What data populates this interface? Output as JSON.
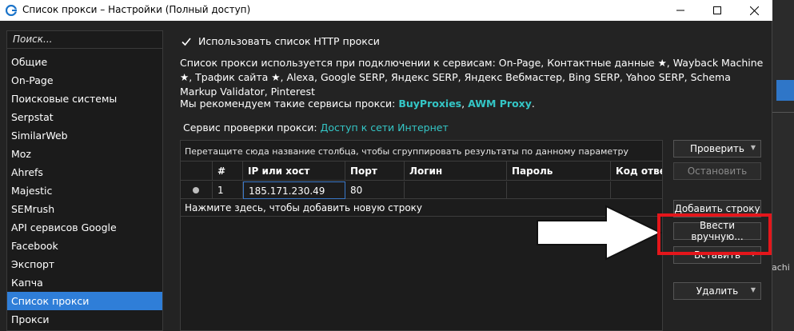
{
  "window": {
    "title": "Список прокси – Настройки (Полный доступ)"
  },
  "icons": {
    "app": "app-logo-icon",
    "minimize": "minimize-icon",
    "maximize": "maximize-icon",
    "close": "close-icon",
    "checkbox": "checkmark-icon",
    "dropdown": "chevron-down-icon",
    "arrow": "arrow-right-icon"
  },
  "colors": {
    "accent": "#2f7ed8",
    "link": "#34c6c6",
    "highlight": "#e4161b"
  },
  "sidebar": {
    "search_placeholder": "Поиск...",
    "items": [
      {
        "label": "Общие"
      },
      {
        "label": "On-Page"
      },
      {
        "label": "Поисковые системы"
      },
      {
        "label": "Serpstat"
      },
      {
        "label": "SimilarWeb"
      },
      {
        "label": "Moz"
      },
      {
        "label": "Ahrefs"
      },
      {
        "label": "Majestic"
      },
      {
        "label": "SEMrush"
      },
      {
        "label": "API сервисов Google"
      },
      {
        "label": "Facebook"
      },
      {
        "label": "Экспорт"
      },
      {
        "label": "Капча"
      },
      {
        "label": "Список прокси",
        "active": true
      },
      {
        "label": "Прокси"
      }
    ]
  },
  "main": {
    "use_list_label": "Использовать список HTTP прокси",
    "use_list_checked": true,
    "description": "Список прокси используется при подключении к сервисам: On-Page, Контактные данные ★, Wayback Machine ★, Трафик сайта ★, Alexa, Google SERP, Яндекс SERP, Яндекс Вебмастер, Bing SERP, Yahoo SERP, Schema Markup Validator, Pinterest",
    "recommend_prefix": "Мы рекомендуем такие сервисы прокси: ",
    "recommend_link1": "BuyProxies",
    "recommend_sep": ", ",
    "recommend_link2": "AWM Proxy",
    "recommend_suffix": ".",
    "check_service_prefix": "Сервис проверки прокси: ",
    "check_service_link": "Доступ к сети Интернет"
  },
  "grid": {
    "group_hint": "Перетащите сюда название столбца, чтобы сгруппировать результаты по данному параметру",
    "columns": [
      "#",
      "IP или хост",
      "Порт",
      "Логин",
      "Пароль",
      "Код ответ"
    ],
    "rows": [
      {
        "num": "1",
        "ip": "185.171.230.49",
        "port": "80",
        "login": "",
        "password": "",
        "code": ""
      }
    ],
    "new_row_hint": "Нажмите здесь, чтобы добавить новую строку"
  },
  "buttons": {
    "check": "Проверить",
    "stop": "Остановить",
    "add_row": "Добавить строку",
    "manual": "Ввести вручную...",
    "paste": "Вставить",
    "delete": "Удалить"
  },
  "background_app": {
    "fragment": "achi"
  }
}
